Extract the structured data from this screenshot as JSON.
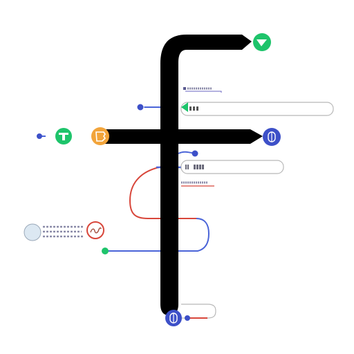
{
  "diagram": {
    "description_free": true,
    "colors": {
      "trunk": "#000000",
      "green": "#1ec46b",
      "blue": "#3d50c8",
      "orange": "#f2a43a",
      "red": "#d8463a",
      "pale_blue": "#dce8f2",
      "field_border": "#b8b8b8",
      "scribble_gray": "#8a8aa8"
    },
    "icons": {
      "top_right_node": "chevron-down-icon",
      "left_green_node": "tee-icon",
      "orange_node": "document-icon",
      "right_blue_node": "capsule-icon",
      "bottom_blue_node": "capsule-icon",
      "red_ring_node": "squiggle-icon",
      "pale_node": "circle-icon"
    },
    "fields": [
      {
        "id": "field-1",
        "value": ""
      },
      {
        "id": "field-2",
        "value": ""
      },
      {
        "id": "field-3",
        "value": ""
      }
    ]
  }
}
